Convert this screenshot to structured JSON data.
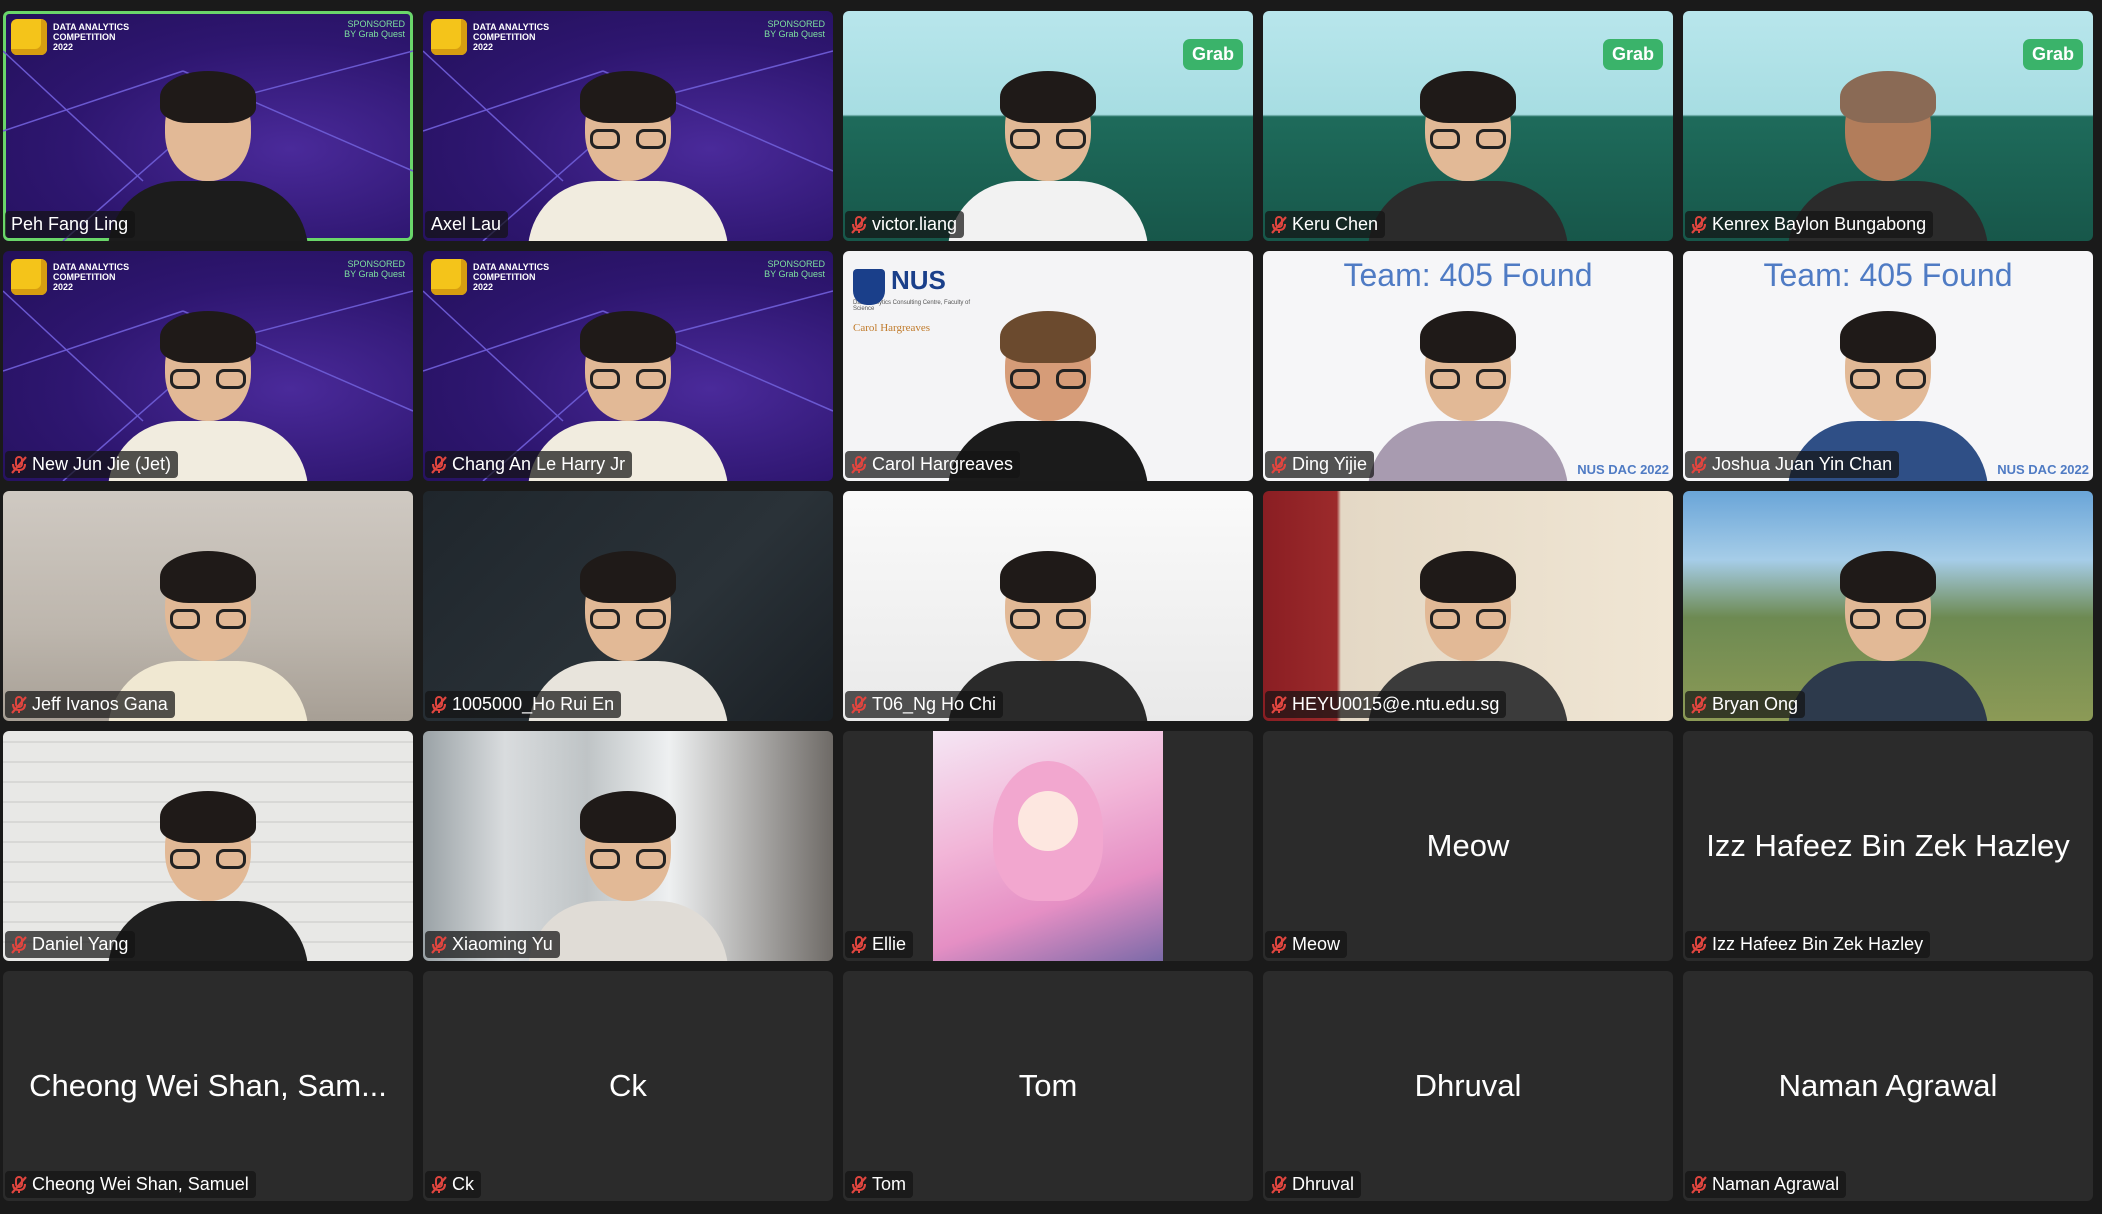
{
  "participants": [
    {
      "name": "Peh Fang Ling",
      "muted": false,
      "bg": "dac",
      "active": true
    },
    {
      "name": "Axel Lau",
      "muted": false,
      "bg": "dac"
    },
    {
      "name": "victor.liang",
      "muted": true,
      "bg": "grab"
    },
    {
      "name": "Keru Chen",
      "muted": true,
      "bg": "grab"
    },
    {
      "name": "Kenrex Baylon Bungabong",
      "muted": true,
      "bg": "grab"
    },
    {
      "name": "New Jun Jie (Jet)",
      "muted": true,
      "bg": "dac"
    },
    {
      "name": "Chang An Le Harry Jr",
      "muted": true,
      "bg": "dac"
    },
    {
      "name": "Carol Hargreaves",
      "muted": true,
      "bg": "nus"
    },
    {
      "name": "Ding Yijie",
      "muted": true,
      "bg": "team"
    },
    {
      "name": "Joshua Juan Yin Chan",
      "muted": true,
      "bg": "team"
    },
    {
      "name": "Jeff Ivanos Gana",
      "muted": true,
      "bg": "room"
    },
    {
      "name": "1005000_Ho Rui En",
      "muted": true,
      "bg": "dark"
    },
    {
      "name": "T06_Ng Ho Chi",
      "muted": true,
      "bg": "bw"
    },
    {
      "name": "HEYU0015@e.ntu.edu.sg",
      "muted": true,
      "bg": "red"
    },
    {
      "name": "Bryan Ong",
      "muted": true,
      "bg": "alps"
    },
    {
      "name": "Daniel Yang",
      "muted": true,
      "bg": "brick"
    },
    {
      "name": "Xiaoming Yu",
      "muted": true,
      "bg": "glass"
    },
    {
      "name": "Ellie",
      "muted": true,
      "bg": "anime"
    },
    {
      "name": "Meow",
      "muted": true,
      "bg": "none",
      "display": "Meow"
    },
    {
      "name": "Izz Hafeez Bin Zek Hazley",
      "muted": true,
      "bg": "none",
      "display": "Izz Hafeez Bin Zek Hazley"
    },
    {
      "name": "Cheong Wei Shan, Samuel",
      "muted": true,
      "bg": "none",
      "display": "Cheong Wei Shan, Sam..."
    },
    {
      "name": "Ck",
      "muted": true,
      "bg": "none",
      "display": "Ck"
    },
    {
      "name": "Tom",
      "muted": true,
      "bg": "none",
      "display": "Tom"
    },
    {
      "name": "Dhruval",
      "muted": true,
      "bg": "none",
      "display": "Dhruval"
    },
    {
      "name": "Naman Agrawal",
      "muted": true,
      "bg": "none",
      "display": "Naman Agrawal"
    }
  ],
  "branding": {
    "dac_logo_text": "DATA ANALYTICS COMPETITION 2022",
    "sponsor_text": "SPONSORED BY Grab Quest",
    "grab_label": "Grab",
    "team_title": "Team: 405 Found",
    "dac_mark": "NUS DAC 2022",
    "nus_title": "NUS",
    "nus_sub": "Data Analytics Consulting Centre, Faculty of Science",
    "nus_name": "Carol Hargreaves"
  },
  "colors": {
    "active_speaker": "#6ad66a",
    "muted_icon": "#e0453f",
    "tile_bg": "#2b2b2b",
    "window_bg": "#1a1a1a"
  }
}
